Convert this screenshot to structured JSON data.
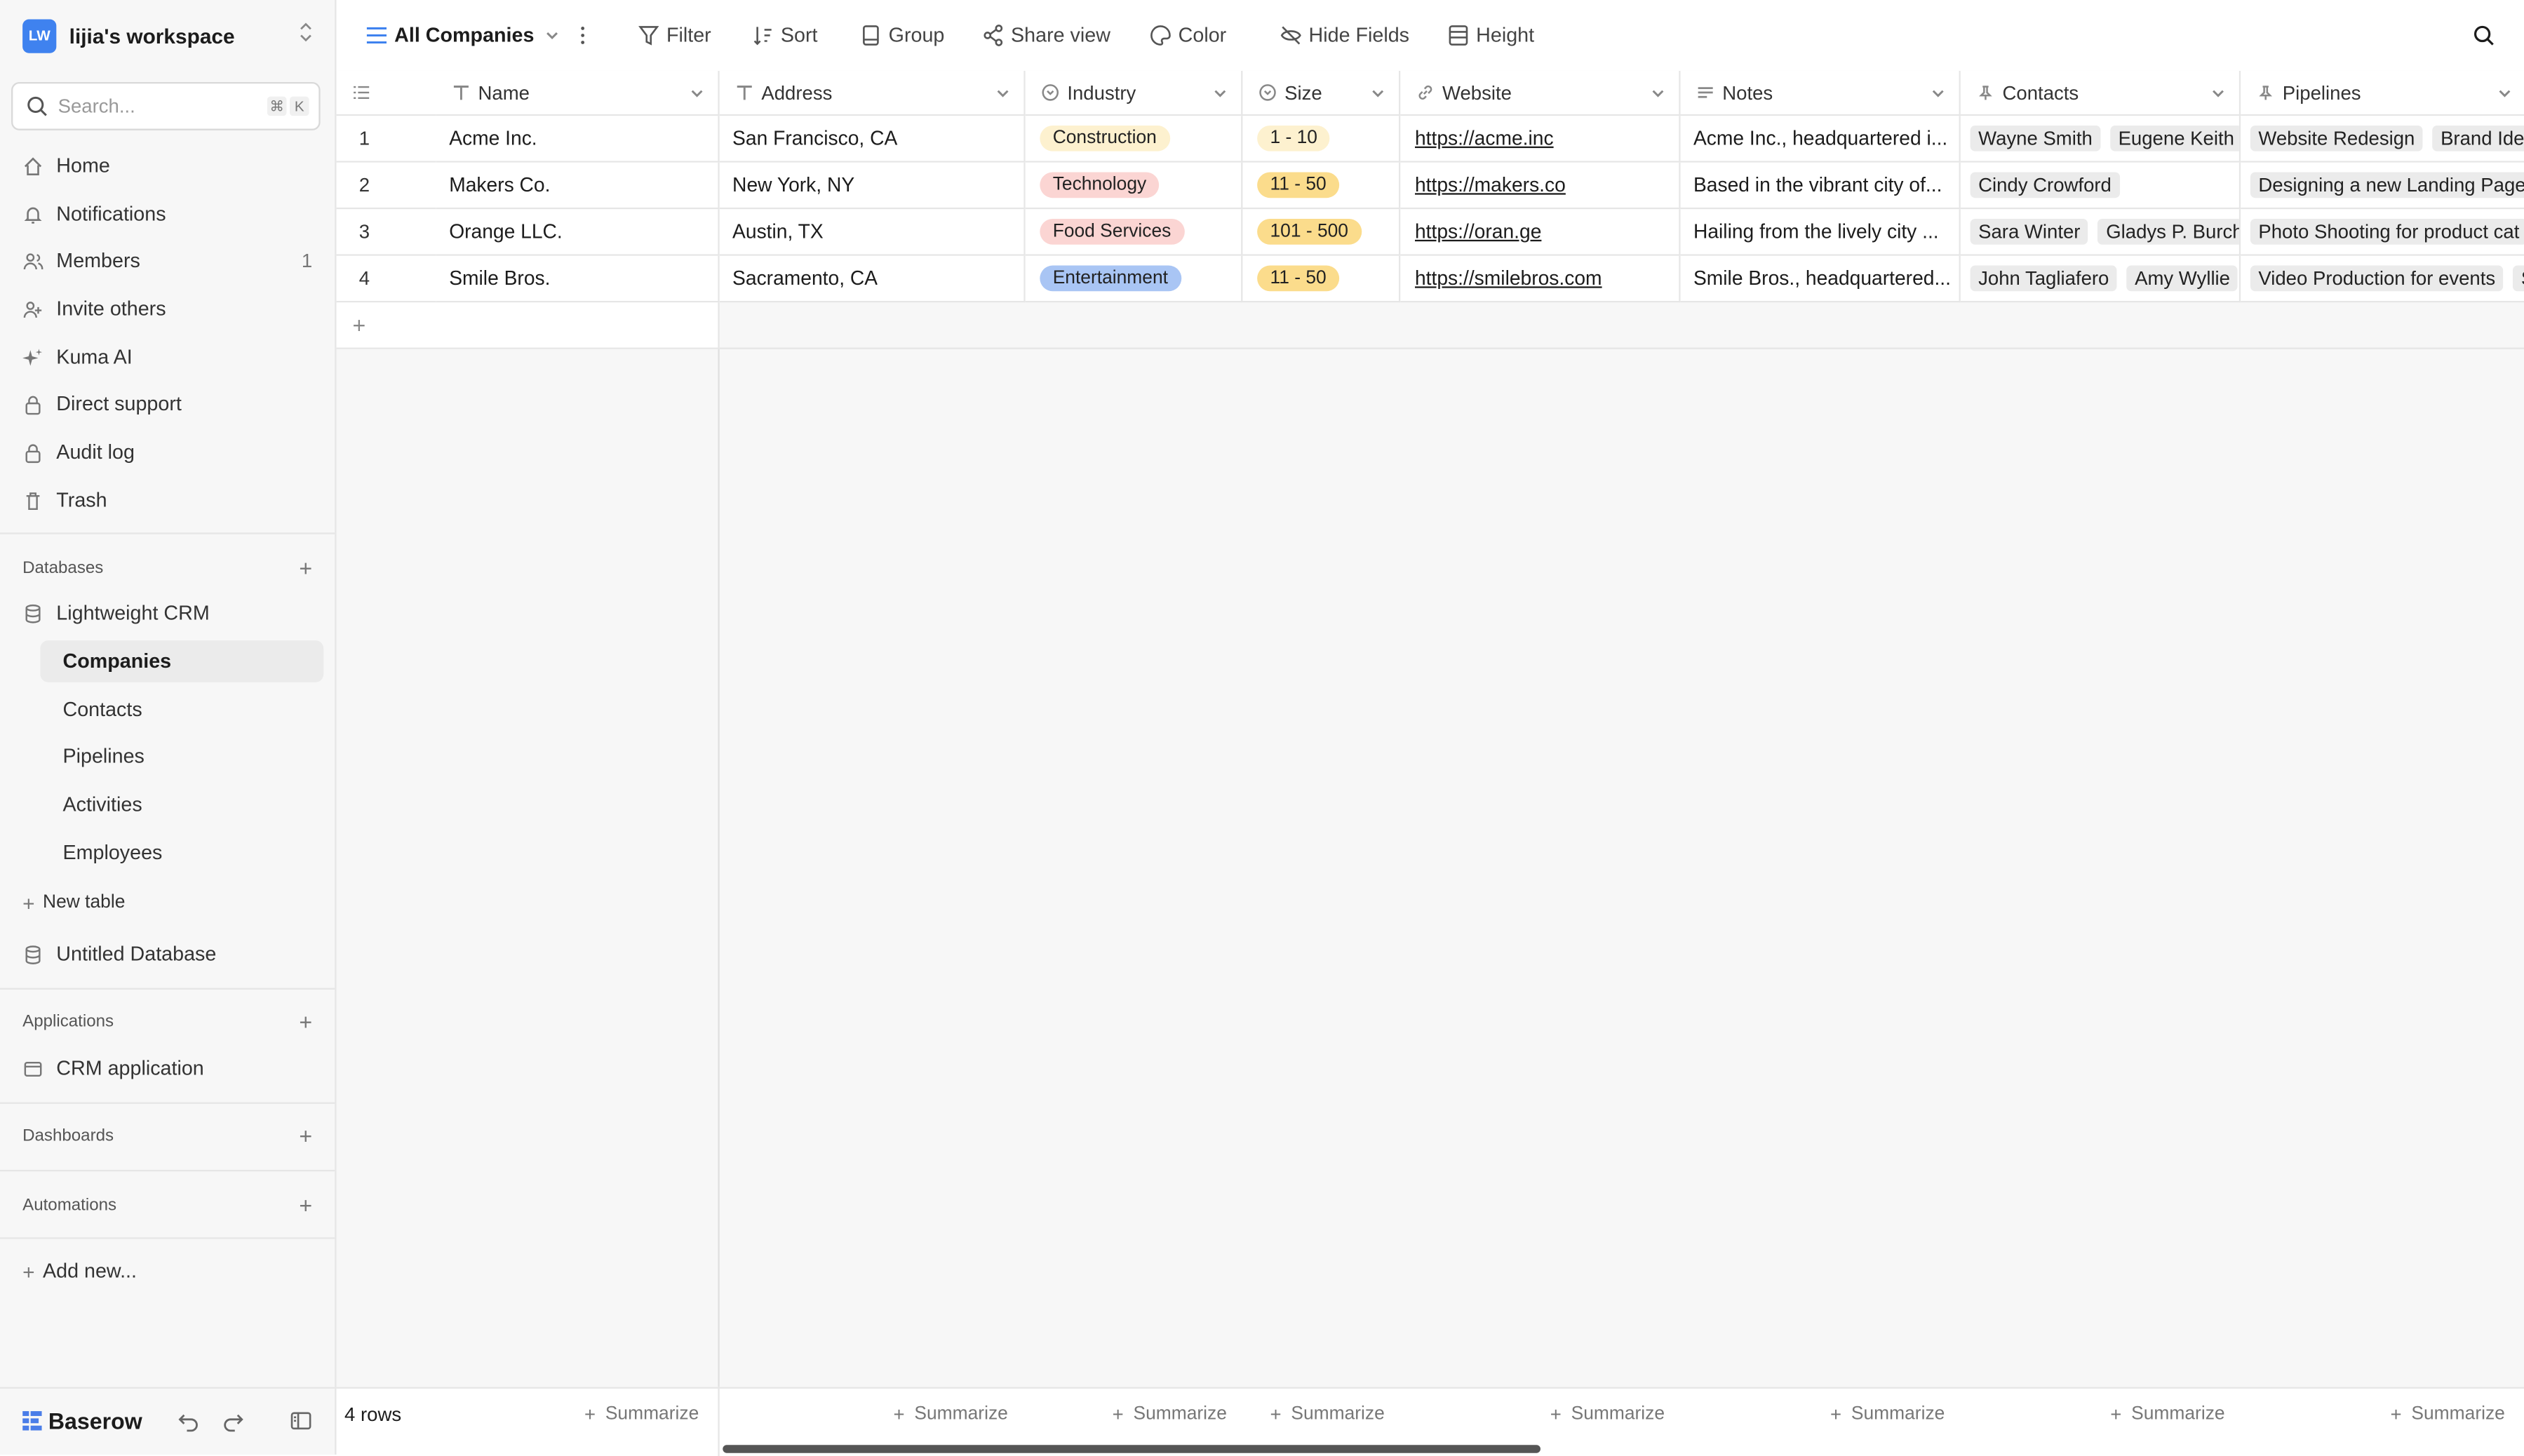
{
  "workspace": {
    "initials": "LW",
    "name": "lijia's workspace"
  },
  "search": {
    "placeholder": "Search...",
    "shortcut_cmd": "⌘",
    "shortcut_key": "K"
  },
  "nav": [
    {
      "label": "Home",
      "icon": "home-icon"
    },
    {
      "label": "Notifications",
      "icon": "bell-icon"
    },
    {
      "label": "Members",
      "icon": "members-icon",
      "count": "1"
    },
    {
      "label": "Invite others",
      "icon": "add-user-icon"
    },
    {
      "label": "Kuma AI",
      "icon": "sparkle-icon"
    },
    {
      "label": "Direct support",
      "icon": "lock-icon"
    },
    {
      "label": "Audit log",
      "icon": "lock-icon"
    },
    {
      "label": "Trash",
      "icon": "trash-icon"
    }
  ],
  "databases": {
    "heading": "Databases",
    "db1": "Lightweight CRM",
    "tables": [
      "Companies",
      "Contacts",
      "Pipelines",
      "Activities",
      "Employees"
    ],
    "new_table": "New table",
    "db2": "Untitled Database"
  },
  "applications": {
    "heading": "Applications",
    "item": "CRM application"
  },
  "dashboards": {
    "heading": "Dashboards"
  },
  "automations": {
    "heading": "Automations"
  },
  "add_new": "Add new...",
  "brand": "Baserow",
  "toolbar": {
    "view": "All Companies",
    "filter": "Filter",
    "sort": "Sort",
    "group": "Group",
    "share": "Share view",
    "color": "Color",
    "hide": "Hide Fields",
    "height": "Height"
  },
  "columns": [
    "Name",
    "Address",
    "Industry",
    "Size",
    "Website",
    "Notes",
    "Contacts",
    "Pipelines"
  ],
  "rows": [
    {
      "id": "1",
      "name": "Acme Inc.",
      "address": "San Francisco, CA",
      "industry": "Construction",
      "size": "1 - 10",
      "website": "https://acme.inc",
      "notes": "Acme Inc., headquartered i...",
      "contacts": [
        "Wayne Smith",
        "Eugene Keith"
      ],
      "pipelines": [
        "Website Redesign",
        "Brand Iden"
      ]
    },
    {
      "id": "2",
      "name": "Makers Co.",
      "address": "New York, NY",
      "industry": "Technology",
      "size": "11 - 50",
      "website": "https://makers.co",
      "notes": "Based in the vibrant city of...",
      "contacts": [
        "Cindy Crowford"
      ],
      "pipelines": [
        "Designing a new Landing Page"
      ]
    },
    {
      "id": "3",
      "name": "Orange LLC.",
      "address": "Austin, TX",
      "industry": "Food Services",
      "size": "101 - 500",
      "website": "https://oran.ge",
      "notes": "Hailing from the lively city ...",
      "contacts": [
        "Sara Winter",
        "Gladys P. Burchfi"
      ],
      "pipelines": [
        "Photo Shooting for product cat"
      ]
    },
    {
      "id": "4",
      "name": "Smile Bros.",
      "address": "Sacramento, CA",
      "industry": "Entertainment",
      "size": "11 - 50",
      "website": "https://smilebros.com",
      "notes": "Smile Bros., headquartered...",
      "contacts": [
        "John Tagliafero",
        "Amy Wyllie"
      ],
      "pipelines": [
        "Video Production for events",
        "S"
      ]
    }
  ],
  "colors": {
    "Construction": "#fdf1cf",
    "Technology": "#fbd5d3",
    "Food Services": "#fbd5d3",
    "Entertainment": "#a9c5f4",
    "1 - 10": "#fdf1cf",
    "11 - 50": "#fbdc8c",
    "101 - 500": "#fbdc8c",
    "accent": "#3f82ef"
  },
  "footer": {
    "rows_count": "4 rows",
    "summarize": "Summarize"
  }
}
